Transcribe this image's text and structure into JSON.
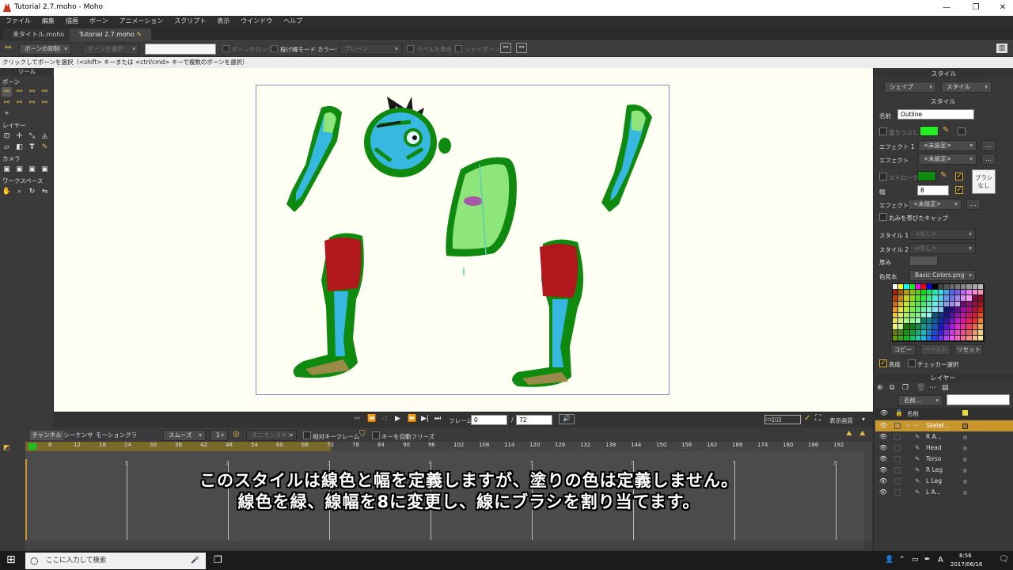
{
  "window": {
    "title": "Tutorial 2.7.moho - Moho",
    "min": "—",
    "max": "❐",
    "close": "✕"
  },
  "menu": [
    "ファイル",
    "編集",
    "描画",
    "ボーン",
    "アニメーション",
    "スクリプト",
    "表示",
    "ウインドウ",
    "ヘルプ"
  ],
  "doc_tabs": [
    "未タイトル.moho",
    "Tutorial 2.7.moho"
  ],
  "toolbar": {
    "bone_constraint": "ボーンの抑制",
    "bone_select": "ボーンを選択",
    "bone_lock": "ボーンをロック",
    "throw_mode": "投げ縄モード",
    "color_label": "カラー:",
    "color_value": "プレーン",
    "show_labels": "ラベルを表示",
    "shy_bones": "シャイボーン"
  },
  "status": {
    "text": "クリックしてボーンを選択（<shift> キーまたは <ctrl/cmd> キーで複数のボーンを選択）",
    "frame": "フレーム：0"
  },
  "tools": {
    "header": "ツール",
    "bone": "ボーン",
    "layer": "レイヤー",
    "camera": "カメラ",
    "workspace": "ワークスペース"
  },
  "style_panel": {
    "header": "スタイル",
    "shape_tab": "シェイプ",
    "style_tab": "スタイル",
    "subheader": "スタイル",
    "name_label": "名前",
    "name_value": "Outline",
    "fill_label": "塗りつぶし",
    "effect1_label": "エフェクト 1",
    "effect1_value": "<未設定>",
    "effect_label": "エフェクト",
    "effect_value": "<未設定>",
    "stroke_label": "ストローク",
    "width_label": "幅",
    "width_value": "8",
    "brush_line1": "ブラシ",
    "brush_line2": "なし",
    "effect3_label": "エフェクト",
    "effect3_value": "<未設定>",
    "round_caps": "丸みを帯びたキャップ",
    "style1_label": "スタイル 1",
    "style1_value": "<なし>",
    "style2_label": "スタイル 2",
    "style2_value": "<なし>",
    "depth_label": "厚み",
    "swatch_label": "色見本",
    "swatch_value": "Basic Colors.png",
    "copy": "コピー",
    "paste": "ペースト",
    "reset": "リセット",
    "advanced": "高度",
    "checker": "チェッカー選択",
    "fill_color": "#22ee22",
    "stroke_color": "#0f8a0f"
  },
  "layers_panel": {
    "header": "レイヤー",
    "name_dropdown": "名前...",
    "name_col": "名前",
    "rows": [
      "Skelet...",
      "R A...",
      "Head",
      "Torso",
      "R Leg",
      "L Leg",
      "L A..."
    ]
  },
  "playbar": {
    "frame_label": "フレーム",
    "frame_value": "0",
    "sep": "/",
    "end_frame": "72",
    "display_quality": "表示画質"
  },
  "timeline": {
    "tabs": [
      "チャンネル",
      "シーケンサ",
      "モーショングラフ"
    ],
    "interp": "スムーズ",
    "interp_n": "1",
    "onion": "オニオンスキン",
    "relative_kf": "相対キーフレーム",
    "auto_freeze": "キーを自動フリーズ",
    "ticks": [
      "6",
      "12",
      "18",
      "24",
      "30",
      "36",
      "42",
      "48",
      "54",
      "60",
      "66",
      "72",
      "78",
      "84",
      "90",
      "96",
      "102",
      "108",
      "114",
      "120",
      "126",
      "132",
      "138",
      "144",
      "150",
      "156",
      "162",
      "168",
      "174",
      "180",
      "186",
      "192"
    ],
    "seconds": [
      "1",
      "2",
      "3",
      "4",
      "5",
      "6",
      "7",
      "8"
    ]
  },
  "caption": {
    "line1": "このスタイルは線色と幅を定義しますが、塗りの色は定義しません。",
    "line2": "線色を緑、線幅を8に変更し、線にブラシを割り当てます。"
  },
  "taskbar": {
    "search_placeholder": "ここに入力して検索",
    "time": "8:56",
    "date": "2017/06/16",
    "ime": "A"
  }
}
